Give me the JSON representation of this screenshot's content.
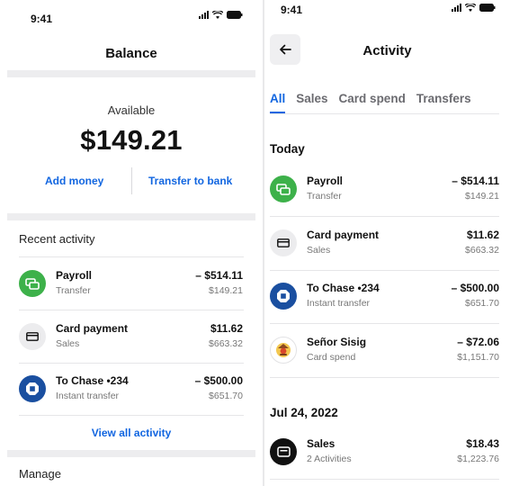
{
  "left_screen": {
    "status": {
      "time": "9:41"
    },
    "title": "Balance",
    "available_label": "Available",
    "balance": "$149.21",
    "actions": {
      "add_money": "Add money",
      "transfer_to_bank": "Transfer to bank"
    },
    "recent_activity_title": "Recent activity",
    "items": [
      {
        "name": "Payroll",
        "type": "Transfer",
        "amount": "– $514.11",
        "balance": "$149.21",
        "icon": "transfer-icon",
        "icon_color": "#3db14a"
      },
      {
        "name": "Card payment",
        "type": "Sales",
        "amount": "$11.62",
        "balance": "$663.32",
        "icon": "card-icon",
        "icon_color": "#ececee"
      },
      {
        "name": "To Chase •234",
        "type": "Instant transfer",
        "amount": "– $500.00",
        "balance": "$651.70",
        "icon": "chase-logo-icon",
        "icon_color": "#1a4fa0"
      }
    ],
    "view_all": "View all activity",
    "manage_title": "Manage"
  },
  "right_screen": {
    "status": {
      "time": "9:41"
    },
    "title": "Activity",
    "tabs": [
      {
        "label": "All",
        "active": true
      },
      {
        "label": "Sales",
        "active": false
      },
      {
        "label": "Card spend",
        "active": false
      },
      {
        "label": "Transfers",
        "active": false
      }
    ],
    "groups": [
      {
        "title": "Today",
        "items": [
          {
            "name": "Payroll",
            "type": "Transfer",
            "amount": "– $514.11",
            "balance": "$149.21",
            "icon": "transfer-icon",
            "icon_color": "#3db14a"
          },
          {
            "name": "Card payment",
            "type": "Sales",
            "amount": "$11.62",
            "balance": "$663.32",
            "icon": "card-icon",
            "icon_color": "#ececee"
          },
          {
            "name": "To Chase •234",
            "type": "Instant transfer",
            "amount": "– $500.00",
            "balance": "$651.70",
            "icon": "chase-logo-icon",
            "icon_color": "#1a4fa0"
          },
          {
            "name": "Señor Sisig",
            "type": "Card spend",
            "amount": "– $72.06",
            "balance": "$1,151.70",
            "icon": "senor-sisig-logo-icon",
            "icon_color": "#ffffff"
          }
        ]
      },
      {
        "title": "Jul 24, 2022",
        "items": [
          {
            "name": "Sales",
            "type": "2 Activities",
            "amount": "$18.43",
            "balance": "$1,223.76",
            "icon": "sales-register-icon",
            "icon_color": "#111111"
          }
        ]
      }
    ]
  }
}
